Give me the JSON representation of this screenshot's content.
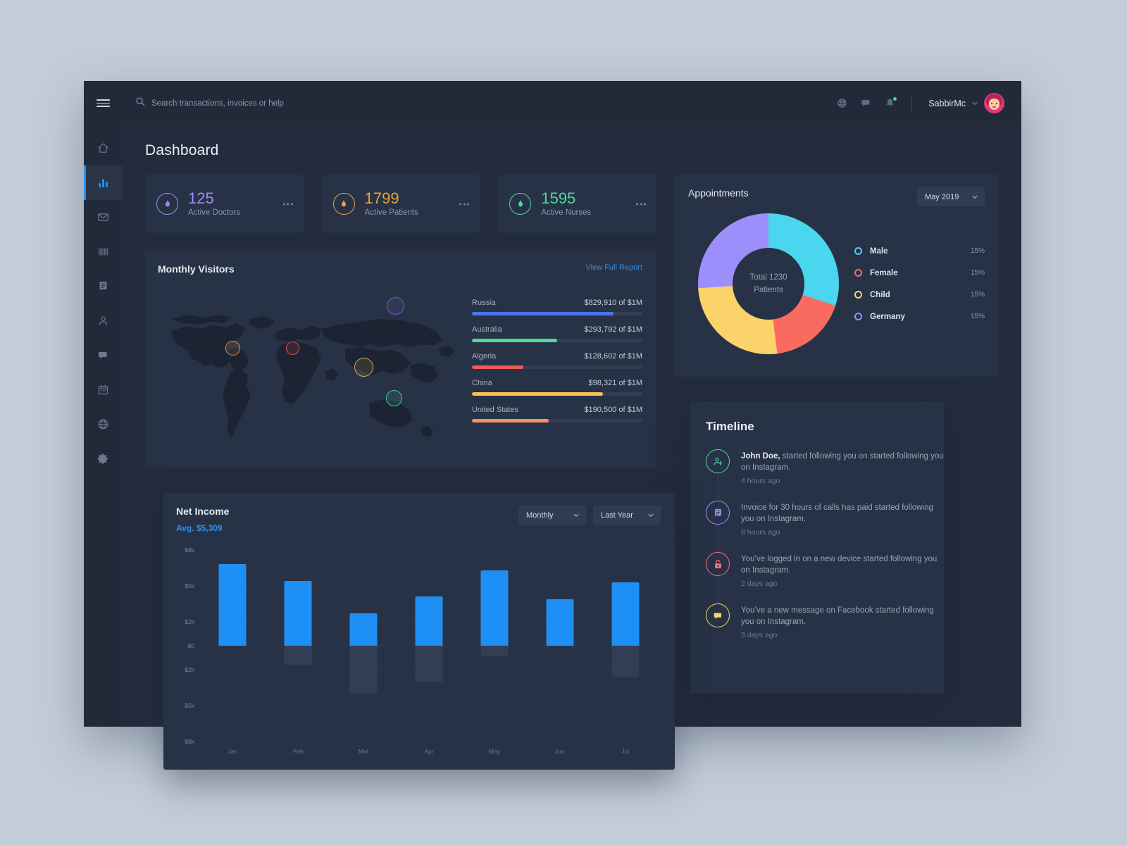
{
  "window": {
    "title": "Dashboard"
  },
  "sidebar": {
    "items": [
      {
        "icon": "home-icon",
        "name": "home",
        "active": false
      },
      {
        "icon": "bar-chart-icon",
        "name": "analytics",
        "active": true
      },
      {
        "icon": "mail-icon",
        "name": "mail",
        "active": false
      },
      {
        "icon": "barcode-icon",
        "name": "barcode",
        "active": false
      },
      {
        "icon": "invoice-icon",
        "name": "invoices",
        "active": false
      },
      {
        "icon": "user-icon",
        "name": "profile",
        "active": false
      },
      {
        "icon": "chat-icon",
        "name": "messages",
        "active": false
      },
      {
        "icon": "calendar-icon",
        "name": "calendar",
        "active": false
      },
      {
        "icon": "globe-icon",
        "name": "globe",
        "active": false
      },
      {
        "icon": "gear-icon",
        "name": "settings",
        "active": false
      }
    ]
  },
  "topbar": {
    "search_placeholder": "Search transactions, invoices or help",
    "search_value": "",
    "icons": [
      "globe-icon",
      "chat-icon",
      "bell-icon"
    ],
    "has_notification": true,
    "user_name": "SabbirMc"
  },
  "stats": [
    {
      "value": "125",
      "label": "Active Doctors",
      "color": "#9b8cfb",
      "icon": "person-badge-icon"
    },
    {
      "value": "1799",
      "label": "Active Patients",
      "color": "#e8a33d",
      "icon": "person-badge-icon"
    },
    {
      "value": "1595",
      "label": "Active Nurses",
      "color": "#4fd99b",
      "icon": "person-badge-icon"
    }
  ],
  "monthly_visitors": {
    "title": "Monthly Visitors",
    "link": "View Full Report",
    "countries": [
      {
        "name": "Russia",
        "value": "$829,910 of $1M",
        "pct": 83,
        "color": "#4d74e8"
      },
      {
        "name": "Australia",
        "value": "$293,792 of $1M",
        "pct": 50,
        "color": "#4fd99b"
      },
      {
        "name": "Algeria",
        "value": "$128,602 of $1M",
        "pct": 30,
        "color": "#ef5b5b"
      },
      {
        "name": "China",
        "value": "$98,321 of $1M",
        "pct": 77,
        "color": "#f5c34f"
      },
      {
        "name": "United States",
        "value": "$190,500 of $1M",
        "pct": 45,
        "color": "#f59265"
      }
    ],
    "markers": [
      {
        "name": "russia-marker",
        "color": "#6f5fc9",
        "x": 325,
        "y": 24,
        "size": 25
      },
      {
        "name": "united-states-marker",
        "color": "#e08a4f",
        "x": 96,
        "y": 86,
        "size": 21
      },
      {
        "name": "algeria-marker",
        "color": "#e04a4a",
        "x": 182,
        "y": 87,
        "size": 19
      },
      {
        "name": "china-marker",
        "color": "#d5a948",
        "x": 279,
        "y": 110,
        "size": 27
      },
      {
        "name": "australia-marker",
        "color": "#3fce96",
        "x": 324,
        "y": 156,
        "size": 23
      }
    ]
  },
  "net_income": {
    "title": "Net Income",
    "avg": "Avg. $5,309",
    "period_select": "Monthly",
    "range_select": "Last Year"
  },
  "appointments": {
    "title": "Appointments",
    "month_select": "May 2019",
    "center_line1": "Total 1230",
    "center_line2": "Patients",
    "legend": [
      {
        "label": "Male",
        "pct": "15%",
        "color": "#4ad6ef"
      },
      {
        "label": "Female",
        "pct": "15%",
        "color": "#fa6b5f"
      },
      {
        "label": "Child",
        "pct": "15%",
        "color": "#fad36b"
      },
      {
        "label": "Germany",
        "pct": "15%",
        "color": "#9d8ffb"
      }
    ]
  },
  "timeline": {
    "title": "Timeline",
    "items": [
      {
        "icon": "user-add-icon",
        "color": "#4fd99b",
        "bold": "John Doe,",
        "message": " started following you on started following you on Instagram.",
        "time": "4 hours ago"
      },
      {
        "icon": "invoice-icon",
        "color": "#9d8ffb",
        "bold": "",
        "message": "Invoice for 30 hours of calls has paid started following you on Instagram.",
        "time": "8 hours ago"
      },
      {
        "icon": "unlock-icon",
        "color": "#fa6b7f",
        "bold": "",
        "message": "You’ve logged in on a new device started following you on Instagram.",
        "time": "2 days ago"
      },
      {
        "icon": "chat-icon",
        "color": "#fad36b",
        "bold": "",
        "message": "You’ve a new message on Facebook started following you on Instagram.",
        "time": "3 days ago"
      }
    ]
  },
  "chart_data": {
    "type": "bar",
    "title": "Net Income",
    "subtitle": "Avg. $5,309",
    "categories": [
      "Jan",
      "Feb",
      "Mar",
      "Apr",
      "May",
      "Jun",
      "Jul"
    ],
    "series": [
      {
        "name": "Positive",
        "values": [
          6800,
          5400,
          2700,
          4100,
          6300,
          3900,
          5300
        ],
        "color": "#1e90f5"
      },
      {
        "name": "Negative",
        "values": [
          0,
          -1600,
          -4000,
          -3000,
          -900,
          0,
          -2600
        ],
        "color": "#333d53"
      }
    ],
    "xlabel": "",
    "ylabel": "",
    "ylim": [
      -8000,
      8000
    ],
    "yticks": [
      8000,
      5000,
      2000,
      0,
      -2000,
      -5000,
      -8000
    ],
    "ytick_labels": [
      "$8k",
      "$5k",
      "$2k",
      "$0",
      "-$2k",
      "-$5k",
      "-$8k"
    ],
    "grid": true,
    "legend": "none"
  },
  "donut_data": {
    "type": "pie",
    "title": "Appointments",
    "labels": [
      "Male",
      "Female",
      "Child",
      "Germany"
    ],
    "values": [
      30,
      18,
      26,
      26
    ],
    "display_percents": [
      "15%",
      "15%",
      "15%",
      "15%"
    ],
    "colors": [
      "#4ad6ef",
      "#fa6b5f",
      "#fad36b",
      "#9d8ffb"
    ],
    "center_text": "Total 1230 Patients"
  }
}
